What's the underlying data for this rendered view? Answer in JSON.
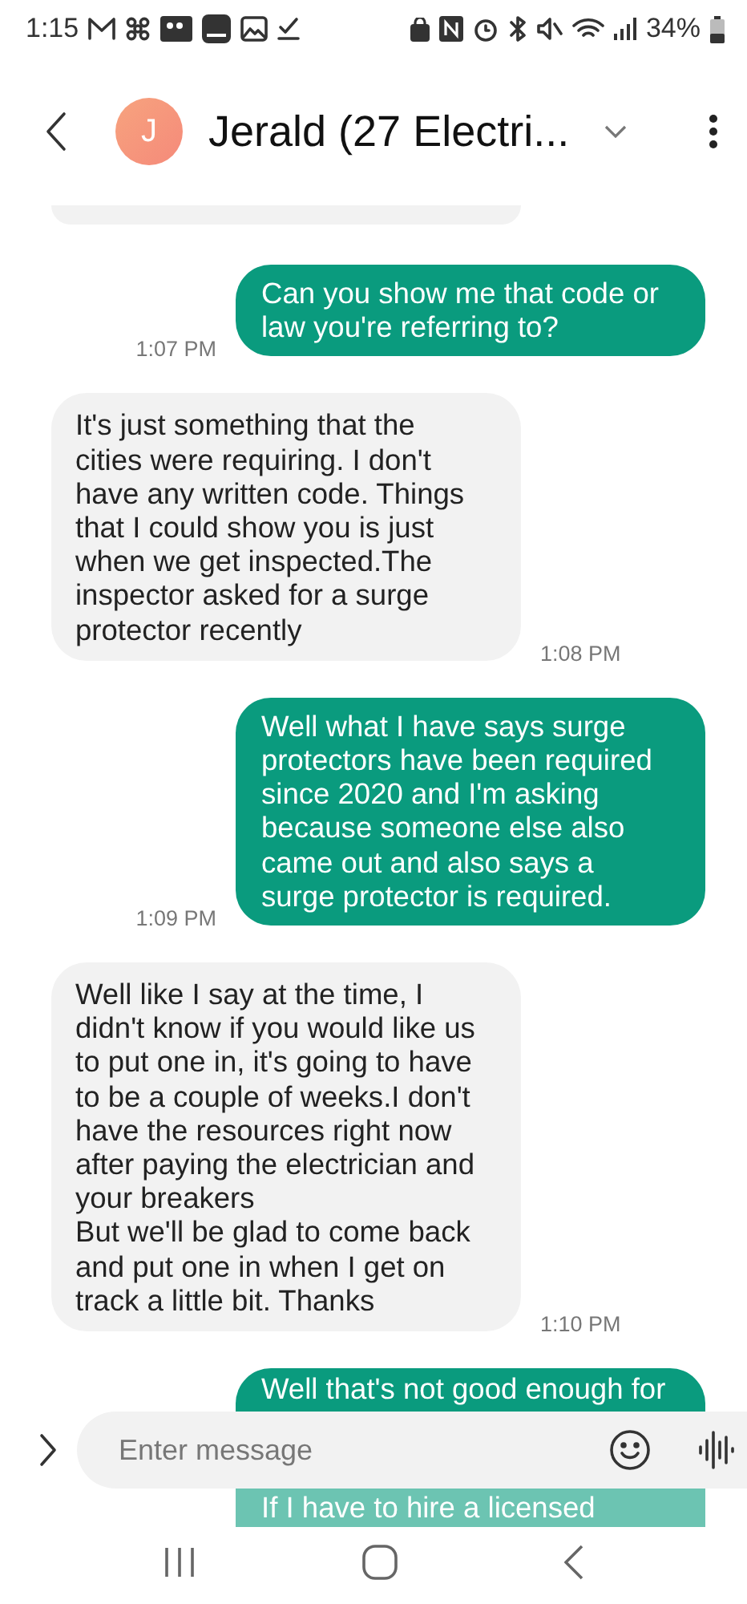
{
  "status_bar": {
    "time": "1:15",
    "battery": "34%"
  },
  "header": {
    "avatar_letter": "J",
    "title": "Jerald (27 Electri..."
  },
  "messages": [
    {
      "kind": "cut"
    },
    {
      "kind": "outgoing",
      "text": "Can you show me that code or law you're referring to?",
      "time": "1:07 PM"
    },
    {
      "kind": "incoming",
      "text": "It's just something that the cities were requiring. I don't have any written code. Things that I could show you is just when we get inspected.The inspector asked for a surge protector recently",
      "time": "1:08 PM"
    },
    {
      "kind": "outgoing",
      "text": "Well what I have says surge protectors have been required since 2020 and I'm asking because someone else also came out and also says a surge protector is required.",
      "time": "1:09 PM"
    },
    {
      "kind": "incoming",
      "text": "Well like I say at the time, I didn't know if you would like us to put one in, it's going to have to be a couple of weeks.I don't have the resources right now after paying the electrician and your breakers\nBut we'll be glad to come back and put one in when I get on track a little bit. Thanks",
      "time": "1:10 PM"
    },
    {
      "kind": "partial",
      "lines": [
        "Well that's not good enough for",
        "If I have to hire a licensed"
      ]
    }
  ],
  "composer": {
    "placeholder": "Enter message"
  }
}
